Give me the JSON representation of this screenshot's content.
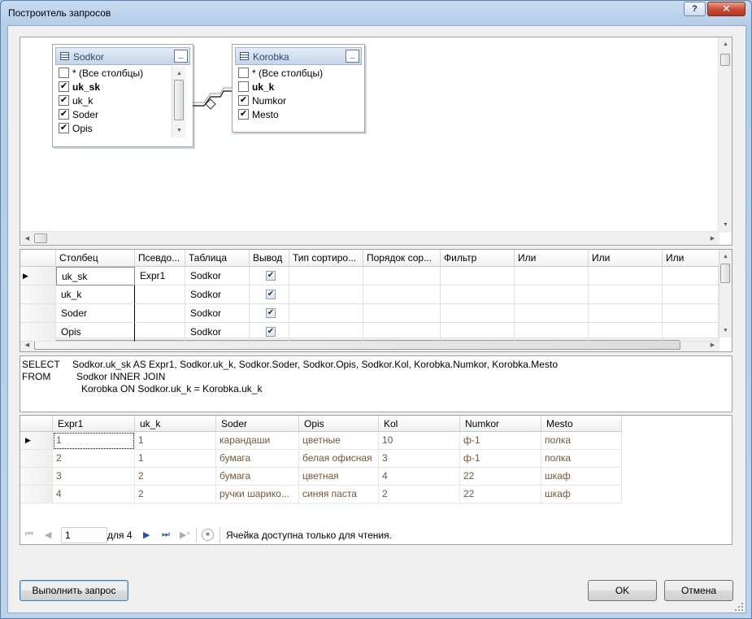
{
  "window": {
    "title": "Построитель запросов",
    "help_label": "?",
    "close_label": "✕"
  },
  "diagram": {
    "tables": [
      {
        "name": "Sodkor",
        "rows": [
          {
            "label": "* (Все столбцы)",
            "checked": false,
            "bold": false
          },
          {
            "label": "uk_sk",
            "checked": true,
            "bold": true
          },
          {
            "label": "uk_k",
            "checked": true,
            "bold": false
          },
          {
            "label": "Soder",
            "checked": true,
            "bold": false
          },
          {
            "label": "Opis",
            "checked": true,
            "bold": false
          }
        ]
      },
      {
        "name": "Korobka",
        "rows": [
          {
            "label": "* (Все столбцы)",
            "checked": false,
            "bold": false
          },
          {
            "label": "uk_k",
            "checked": false,
            "bold": true
          },
          {
            "label": "Numkor",
            "checked": true,
            "bold": false
          },
          {
            "label": "Mesto",
            "checked": true,
            "bold": false
          }
        ]
      }
    ]
  },
  "criteria_grid": {
    "headers": [
      "Столбец",
      "Псевдо...",
      "Таблица",
      "Вывод",
      "Тип сортиро...",
      "Порядок сор...",
      "Фильтр",
      "Или",
      "Или",
      "Или"
    ],
    "rows": [
      {
        "column": "uk_sk",
        "alias": "Expr1",
        "table": "Sodkor",
        "output": true,
        "current": true
      },
      {
        "column": "uk_k",
        "alias": "",
        "table": "Sodkor",
        "output": true,
        "current": false
      },
      {
        "column": "Soder",
        "alias": "",
        "table": "Sodkor",
        "output": true,
        "current": false
      },
      {
        "column": "Opis",
        "alias": "",
        "table": "Sodkor",
        "output": true,
        "current": false
      }
    ]
  },
  "sql": {
    "select_kw": "SELECT",
    "select_text": "Sodkor.uk_sk AS Expr1, Sodkor.uk_k, Sodkor.Soder, Sodkor.Opis, Sodkor.Kol, Korobka.Numkor, Korobka.Mesto",
    "from_kw": "FROM",
    "from_text": "Sodkor INNER JOIN",
    "join_text": "Korobka ON Sodkor.uk_k = Korobka.uk_k"
  },
  "results": {
    "headers": [
      "Expr1",
      "uk_k",
      "Soder",
      "Opis",
      "Kol",
      "Numkor",
      "Mesto"
    ],
    "rows": [
      [
        "1",
        "1",
        "карандаши",
        "цветные",
        "10",
        "ф-1",
        "полка"
      ],
      [
        "2",
        "1",
        "бумага",
        "белая офисная",
        "3",
        "ф-1",
        "полка"
      ],
      [
        "3",
        "2",
        "бумага",
        "цветная",
        "4",
        "22",
        "шкаф"
      ],
      [
        "4",
        "2",
        "ручки шарико...",
        "синяя паста",
        "2",
        "22",
        "шкаф"
      ]
    ]
  },
  "navigator": {
    "position": "1",
    "of_label": "для 4",
    "status": "Ячейка доступна только для чтения."
  },
  "buttons": {
    "execute": "Выполнить запрос",
    "ok": "OK",
    "cancel": "Отмена"
  }
}
